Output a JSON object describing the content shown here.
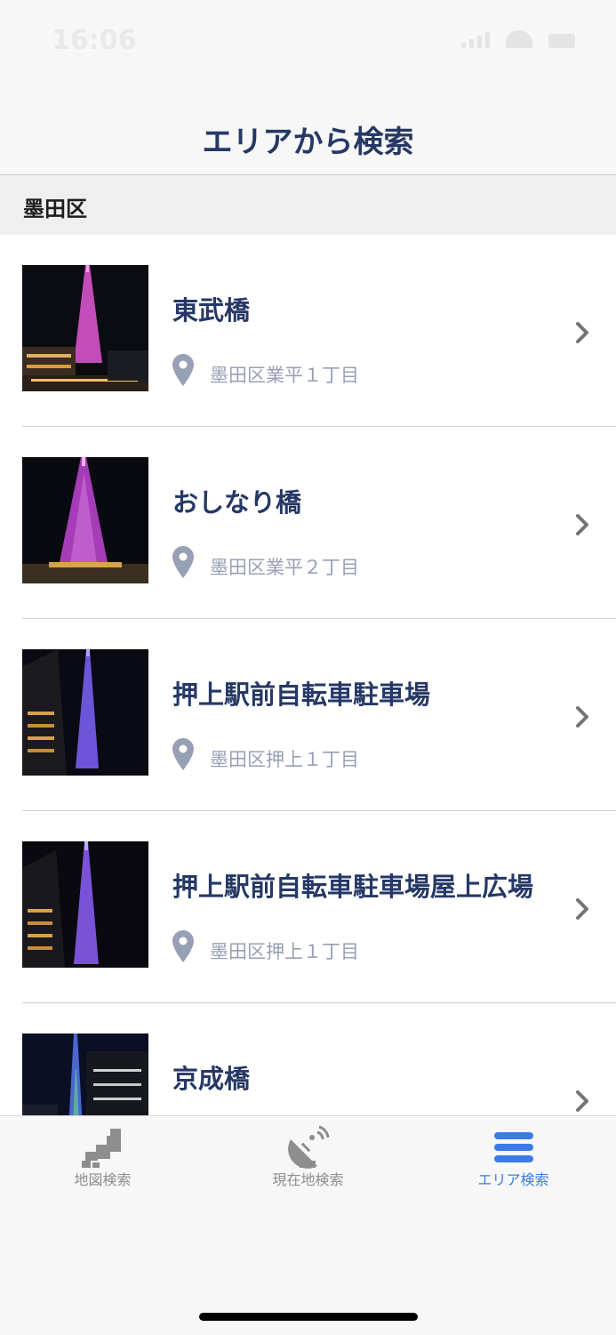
{
  "status_bar": {
    "time": "16:06"
  },
  "header": {
    "title": "エリアから検索"
  },
  "section": {
    "title": "墨田区"
  },
  "list": [
    {
      "name": "東武橋",
      "address": "墨田区業平１丁目",
      "thumb_color": "#c34db8"
    },
    {
      "name": "おしなり橋",
      "address": "墨田区業平２丁目",
      "thumb_color": "#b03fc0"
    },
    {
      "name": "押上駅前自転車駐車場",
      "address": "墨田区押上１丁目",
      "thumb_color": "#6d55d8"
    },
    {
      "name": "押上駅前自転車駐車場屋上広場",
      "address": "墨田区押上１丁目",
      "thumb_color": "#7a52d6"
    },
    {
      "name": "京成橋",
      "address": "",
      "thumb_color": "#4a66d0"
    }
  ],
  "tabs": [
    {
      "label": "地図検索",
      "icon": "japan-map-icon",
      "active": false
    },
    {
      "label": "現在地検索",
      "icon": "satellite-dish-icon",
      "active": false
    },
    {
      "label": "エリア検索",
      "icon": "list-menu-icon",
      "active": true
    }
  ],
  "colors": {
    "title": "#263866",
    "address": "#97a0b4",
    "active_tab": "#3c7be6",
    "inactive_tab": "#8e8e8e"
  }
}
